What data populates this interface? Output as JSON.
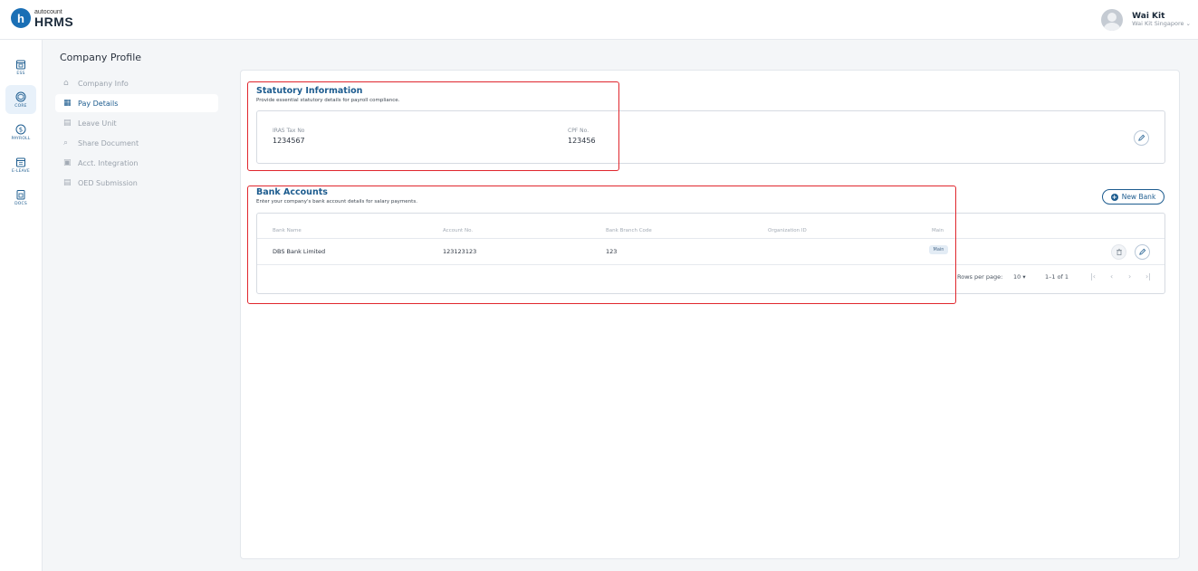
{
  "app": {
    "logo_mark": "h",
    "logo_sub": "autocount",
    "logo_main": "HRMS"
  },
  "user": {
    "name": "Wai Kit",
    "company": "Wai Kit Singapore ⌄"
  },
  "rail": {
    "items": [
      {
        "label": "ESS",
        "icon": "calendar-id-icon"
      },
      {
        "label": "CORE",
        "icon": "cube-icon"
      },
      {
        "label": "PAYROLL",
        "icon": "dollar-icon"
      },
      {
        "label": "E-LEAVE",
        "icon": "calendar-icon"
      },
      {
        "label": "DOCS",
        "icon": "document-icon"
      }
    ],
    "active": "CORE"
  },
  "section": {
    "title": "Company Profile",
    "items": [
      {
        "label": "Company Info",
        "icon": "building-icon"
      },
      {
        "label": "Pay Details",
        "icon": "pay-icon"
      },
      {
        "label": "Leave Unit",
        "icon": "leave-icon"
      },
      {
        "label": "Share Document",
        "icon": "share-icon"
      },
      {
        "label": "Acct. Integration",
        "icon": "integration-icon"
      },
      {
        "label": "OED Submission",
        "icon": "submission-icon"
      }
    ],
    "active": "Pay Details"
  },
  "statutory": {
    "title": "Statutory Information",
    "description": "Provide essential statutory details for payroll compliance.",
    "iras_label": "IRAS Tax No",
    "iras_value": "1234567",
    "cpf_label": "CPF No.",
    "cpf_value": "123456"
  },
  "bank": {
    "title": "Bank Accounts",
    "description": "Enter your company's bank account details for salary payments.",
    "new_button": "New Bank",
    "columns": [
      "Bank Name",
      "Account No.",
      "Bank Branch Code",
      "Organization ID",
      "Main"
    ],
    "rows": [
      {
        "bank_name": "DBS Bank Limited",
        "account_no": "123123123",
        "branch_code": "123",
        "org_id": "",
        "main": "Main"
      }
    ],
    "rows_per_page_label": "Rows per page:",
    "rows_per_page_value": "10 ▾",
    "range": "1–1 of 1"
  },
  "colors": {
    "brand": "#1d5c8f",
    "highlight": "#e0262d",
    "background": "#f4f6f8"
  }
}
